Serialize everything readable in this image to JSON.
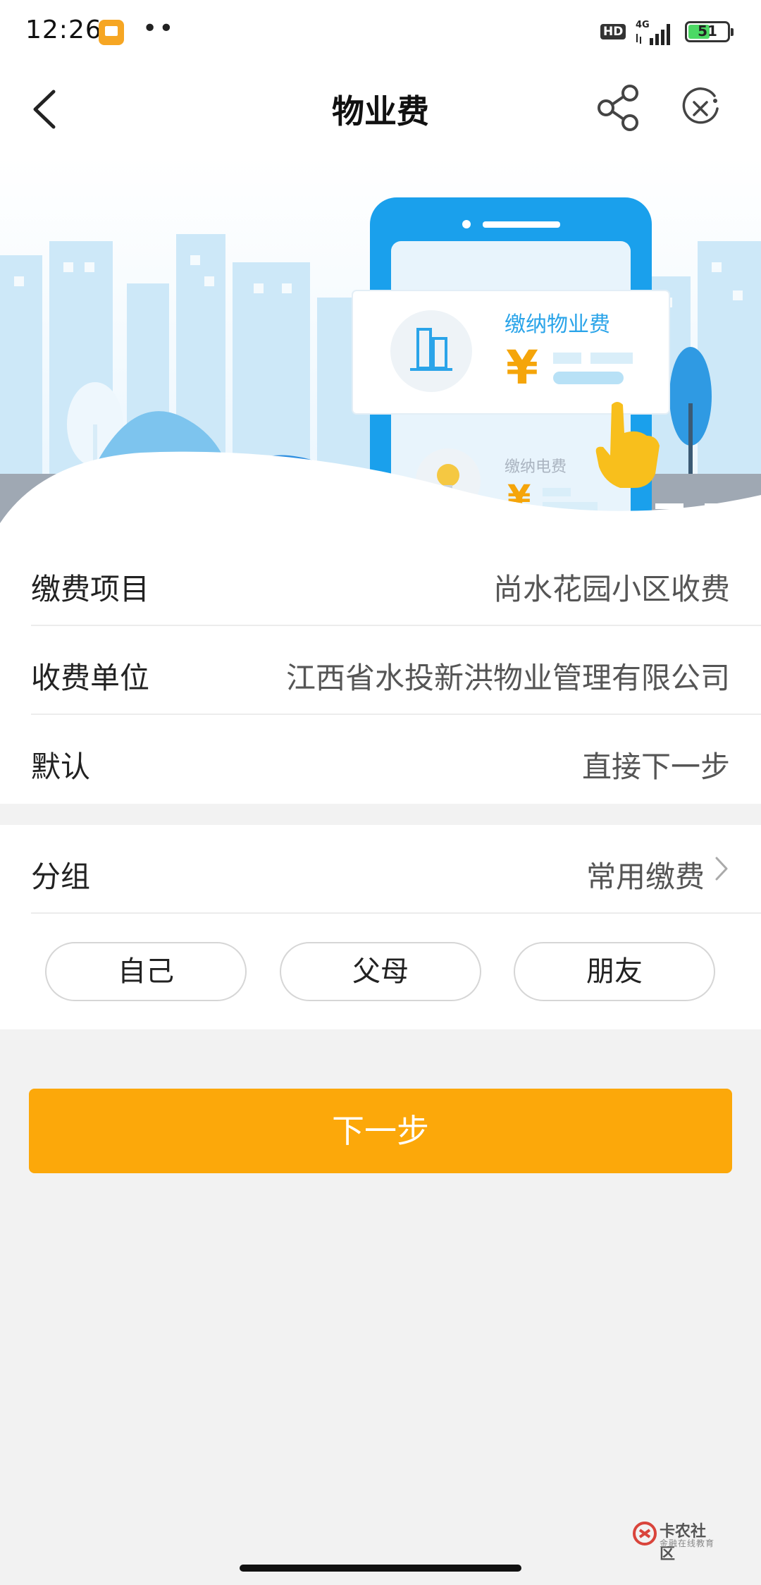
{
  "status_bar": {
    "time": "12:26",
    "dots": "••",
    "hd": "HD",
    "network": "4G",
    "battery": "51"
  },
  "nav": {
    "title": "物业费",
    "back_icon": "back-arrow-icon",
    "share_icon": "share-icon",
    "close_icon": "close-mini-program-icon"
  },
  "banner": {
    "card_title": "缴纳物业费",
    "card_currency": "¥",
    "second_title": "缴纳电费",
    "second_currency": "¥"
  },
  "info_rows": [
    {
      "label": "缴费项目",
      "value": "尚水花园小区收费"
    },
    {
      "label": "收费单位",
      "value": "江西省水投新洪物业管理有限公司"
    },
    {
      "label": "默认",
      "value": "直接下一步"
    }
  ],
  "group": {
    "label": "分组",
    "value": "常用缴费",
    "chips": [
      "自己",
      "父母",
      "朋友"
    ]
  },
  "next_button": "下一步",
  "watermark": {
    "main": "卡农社区",
    "sub": "金融在线教育"
  },
  "colors": {
    "accent": "#fca80a",
    "banner_blue": "#2aa4e9"
  }
}
